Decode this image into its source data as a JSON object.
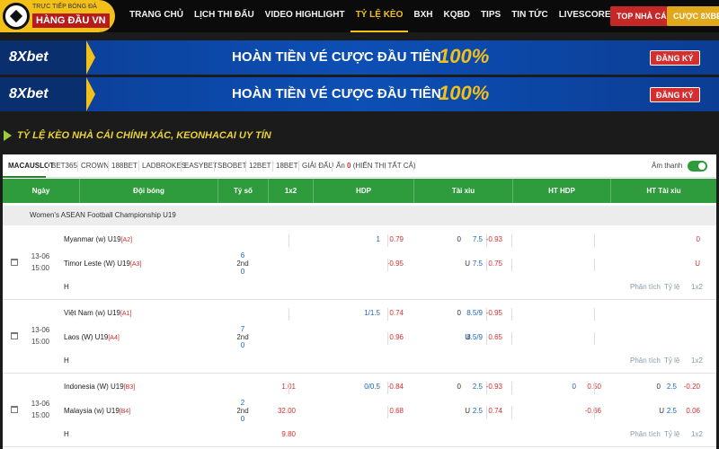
{
  "logo": {
    "tagline": "TRỰC TIẾP BÓNG ĐÁ",
    "title": "HÀNG ĐẦU VN"
  },
  "nav": {
    "items": [
      "TRANG CHỦ",
      "LỊCH THI ĐẤU",
      "VIDEO HIGHLIGHT",
      "TỶ LỆ KÈO",
      "BXH",
      "KQBD",
      "TIPS",
      "TIN TỨC",
      "LIVESCORE",
      "TUYỂN DỤNG"
    ],
    "active": "TỶ LỆ KÈO",
    "top_btn": "TOP NHÀ CÁI",
    "bet_btn": "CƯỢC 8XBET"
  },
  "banners": [
    {
      "brand": "8Xbet",
      "text": "HOÀN TIỀN VÉ CƯỢC ĐẦU TIÊN",
      "pct": "100%",
      "button": "ĐĂNG KÝ"
    },
    {
      "brand": "8Xbet",
      "text": "HOÀN TIỀN VÉ CƯỢC ĐẦU TIÊN",
      "pct": "100%",
      "button": "ĐĂNG KÝ"
    }
  ],
  "heading": "TỶ LỆ KÈO NHÀ CÁI CHÍNH XÁC, KEONHACAI UY TÍN",
  "tabs": [
    "MACAUSLOT",
    "BET365",
    "CROWN",
    "188BET",
    "LADBROKES",
    "EASYBET",
    "SBOBET",
    "12BET",
    "18BET",
    "GIẢI ĐẤU"
  ],
  "hidden": {
    "prefix": "Ẩn",
    "count": "0",
    "action": "(HIỂN THỊ TẤT CẢ)"
  },
  "sound_label": "Âm thanh",
  "sound_on": true,
  "columns": [
    "Ngày",
    "Đội bóng",
    "Tỷ số",
    "1x2",
    "HDP",
    "Tài xỉu",
    "HT HDP",
    "HT Tài xỉu"
  ],
  "league": "Women's ASEAN Football Championship U19",
  "links": {
    "analysis": "Phân tích",
    "odds": "Tỷ lệ",
    "x12": "1x2"
  },
  "matches": [
    {
      "date": "13-06",
      "time": "15:00",
      "home": "Myanmar (w) U19",
      "home_rank": "[A2]",
      "away": "Timor Leste (W) U19",
      "away_rank": "[A3]",
      "draw": "H",
      "score_home": "6",
      "half": "2nd",
      "score_away": "0",
      "x12": [
        "",
        "",
        ""
      ],
      "hdp_line": [
        "1",
        ""
      ],
      "hdp_odds": [
        "0.79",
        "-0.95"
      ],
      "ou_tag": [
        "0",
        "U"
      ],
      "ou_line": [
        "7.5",
        "7.5"
      ],
      "ou_odds": [
        "-0.93",
        "0.75"
      ],
      "hthdp_line": [
        "",
        ""
      ],
      "hthdp_odds": [
        "",
        ""
      ],
      "htou_tag": [
        "",
        ""
      ],
      "htou_line": [
        "",
        ""
      ],
      "htou_odds": [
        "0",
        "U"
      ]
    },
    {
      "date": "13-06",
      "time": "15:00",
      "home": "Việt Nam (w) U19",
      "home_rank": "[A1]",
      "away": "Laos (W) U19",
      "away_rank": "[A4]",
      "draw": "H",
      "score_home": "7",
      "half": "2nd",
      "score_away": "0",
      "x12": [
        "",
        "",
        ""
      ],
      "hdp_line": [
        "1/1.5",
        ""
      ],
      "hdp_odds": [
        "0.74",
        "0.96"
      ],
      "ou_tag": [
        "0",
        "U"
      ],
      "ou_line": [
        "8.5/9",
        "8.5/9"
      ],
      "ou_odds": [
        "-0.95",
        "0.65"
      ],
      "hthdp_line": [
        "",
        ""
      ],
      "hthdp_odds": [
        "",
        ""
      ],
      "htou_tag": [
        "",
        ""
      ],
      "htou_line": [
        "",
        ""
      ],
      "htou_odds": [
        "",
        ""
      ]
    },
    {
      "date": "13-06",
      "time": "15:00",
      "home": "Indonesia (W) U19",
      "home_rank": "[B3]",
      "away": "Malaysia (w) U19",
      "away_rank": "[B4]",
      "draw": "H",
      "score_home": "2",
      "half": "2nd",
      "score_away": "0",
      "x12": [
        "1.01",
        "32.00",
        "9.80"
      ],
      "hdp_line": [
        "0/0.5",
        ""
      ],
      "hdp_odds": [
        "-0.84",
        "0.68"
      ],
      "ou_tag": [
        "0",
        "U"
      ],
      "ou_line": [
        "2.5",
        "2.5"
      ],
      "ou_odds": [
        "-0.93",
        "0.74"
      ],
      "hthdp_line": [
        "0",
        ""
      ],
      "hthdp_odds": [
        "0.50",
        "-0.66"
      ],
      "htou_tag": [
        "0",
        "U"
      ],
      "htou_line": [
        "2.5",
        "2.5"
      ],
      "htou_odds": [
        "-0.20",
        "0.06"
      ]
    }
  ]
}
